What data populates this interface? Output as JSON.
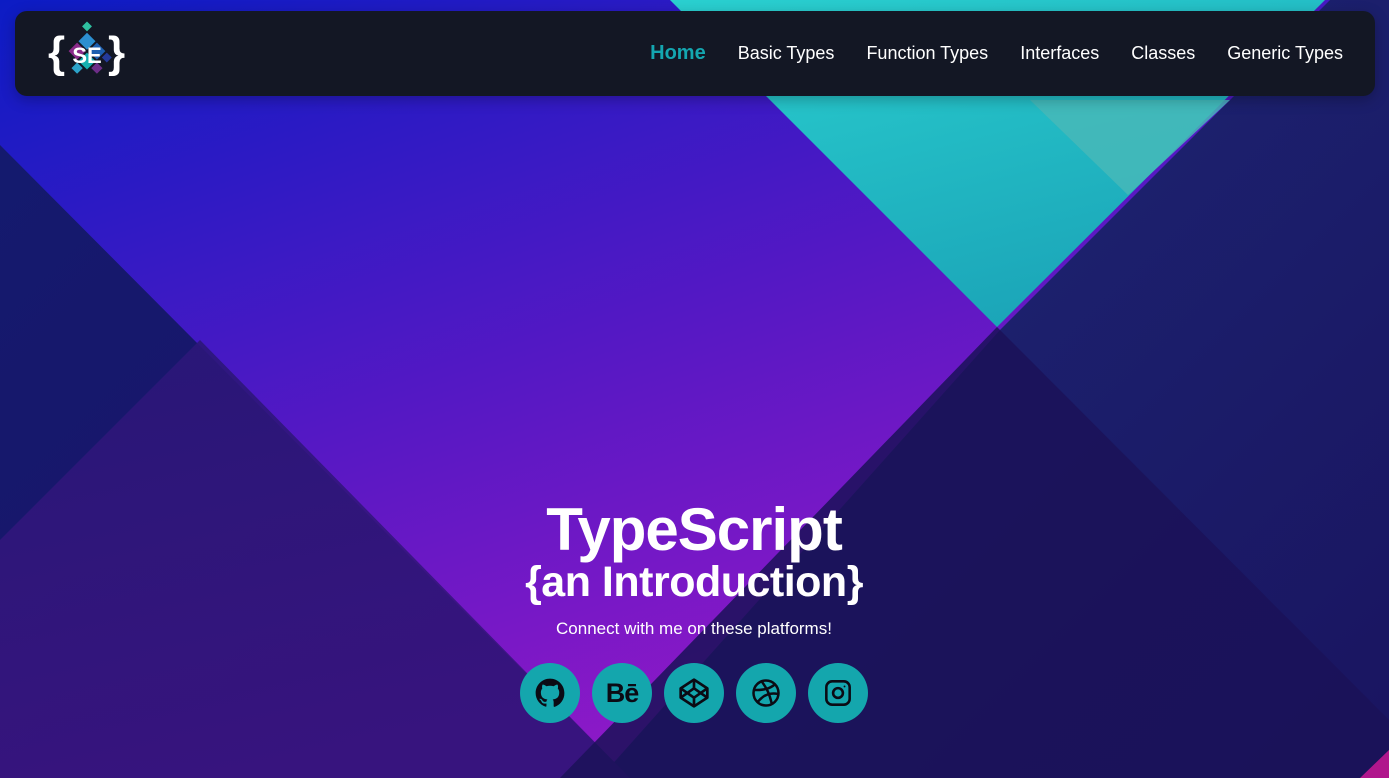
{
  "brand": {
    "logo_text": "SE",
    "logo_icon": "brace-diamond-logo-icon"
  },
  "nav": {
    "items": [
      {
        "label": "Home",
        "active": true
      },
      {
        "label": "Basic Types",
        "active": false
      },
      {
        "label": "Function Types",
        "active": false
      },
      {
        "label": "Interfaces",
        "active": false
      },
      {
        "label": "Classes",
        "active": false
      },
      {
        "label": "Generic Types",
        "active": false
      }
    ]
  },
  "hero": {
    "title": "TypeScript",
    "subtitle": "{an Introduction}",
    "tagline": "Connect with me on these platforms!"
  },
  "socials": [
    {
      "icon": "github-icon"
    },
    {
      "icon": "behance-icon",
      "glyph": "Bē"
    },
    {
      "icon": "codepen-icon"
    },
    {
      "icon": "dribbble-icon"
    },
    {
      "icon": "instagram-icon"
    }
  ],
  "colors": {
    "accent": "#14a6ad",
    "navbar_bg": "#131724",
    "text": "#ffffff"
  }
}
